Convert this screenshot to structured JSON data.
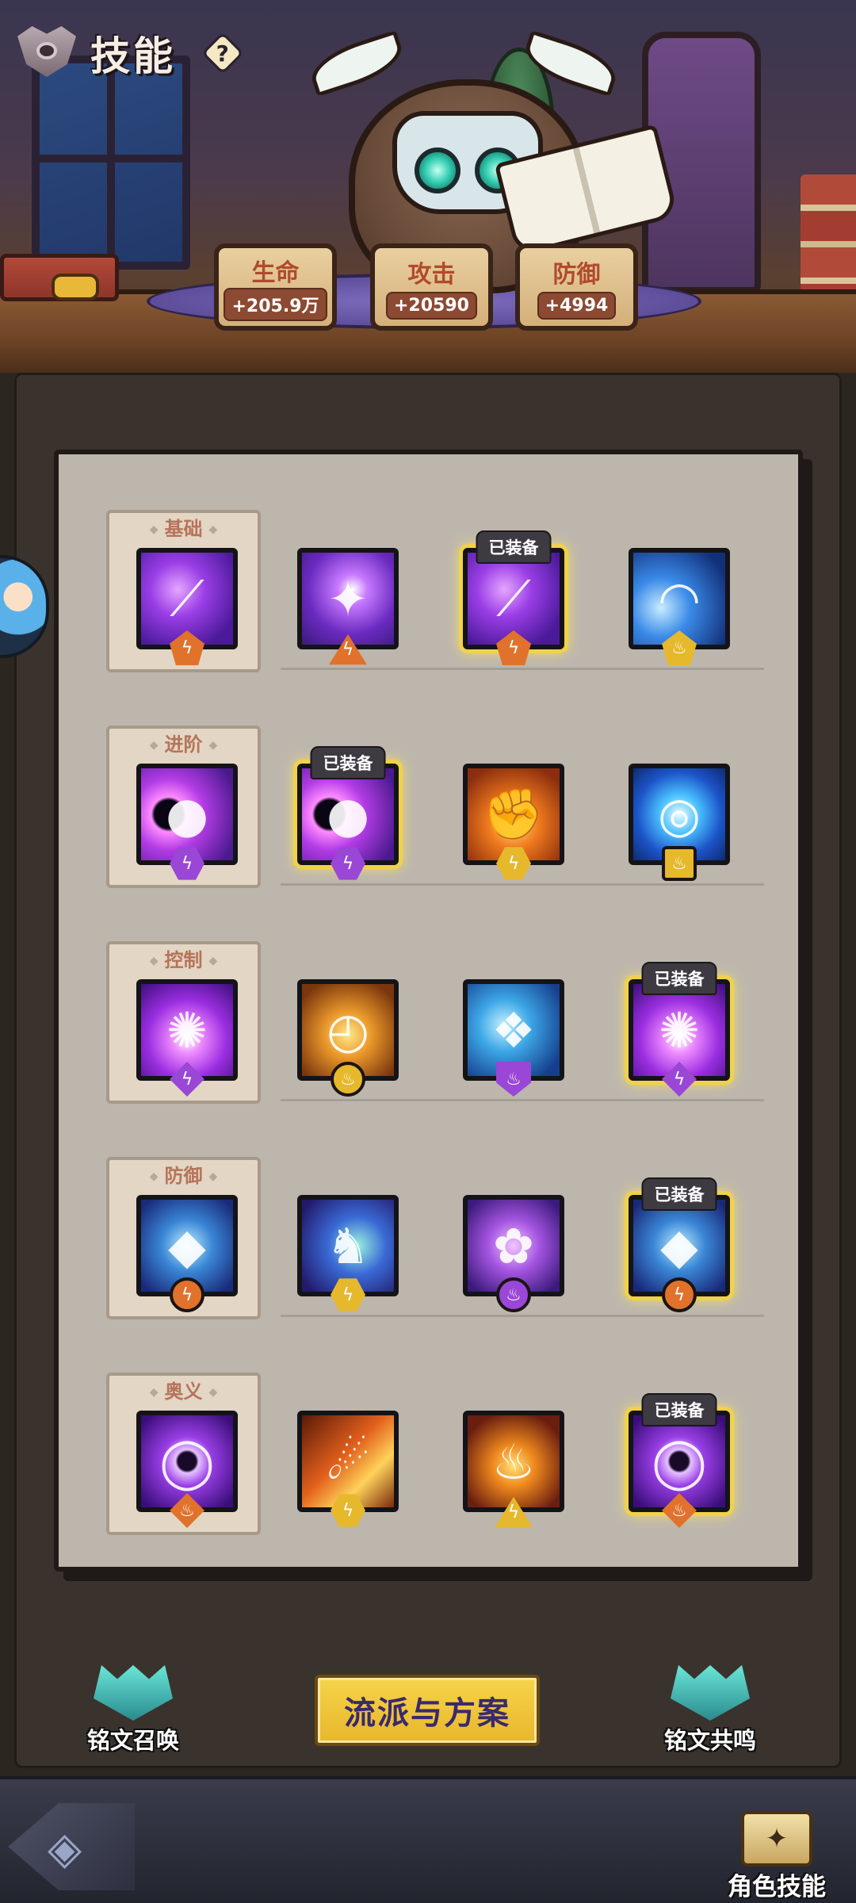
{
  "header": {
    "title": "技能",
    "help_symbol": "?",
    "stats": [
      {
        "label": "生命",
        "value": "+205.9万"
      },
      {
        "label": "攻击",
        "value": "+20590"
      },
      {
        "label": "防御",
        "value": "+4994"
      }
    ]
  },
  "skill_panel": {
    "equipped_tag": "已装备",
    "rows": [
      {
        "category": "基础",
        "skills": [
          {
            "icon": "violet-slash-icon",
            "badge": "orange-lightning",
            "equipped": false
          },
          {
            "icon": "star-burst-icon",
            "badge": "orange-triangle",
            "equipped": false
          },
          {
            "icon": "violet-slash-icon",
            "badge": "orange-lightning",
            "equipped": true
          },
          {
            "icon": "blue-wave-icon",
            "badge": "gold-flame",
            "equipped": false
          }
        ]
      },
      {
        "category": "进阶",
        "skills": [
          {
            "icon": "void-beam-icon",
            "badge": "purple-hex",
            "equipped": false
          },
          {
            "icon": "void-beam-icon",
            "badge": "purple-hex",
            "equipped": true
          },
          {
            "icon": "fire-fist-icon",
            "badge": "gold-hex",
            "equipped": false
          },
          {
            "icon": "water-vortex-icon",
            "badge": "gold-square",
            "equipped": false
          }
        ]
      },
      {
        "category": "控制",
        "skills": [
          {
            "icon": "arcane-burst-icon",
            "badge": "purple-diamond",
            "equipped": false
          },
          {
            "icon": "golden-clock-icon",
            "badge": "gold-circle",
            "equipped": false
          },
          {
            "icon": "frost-ghost-icon",
            "badge": "purple-shield",
            "equipped": false
          },
          {
            "icon": "arcane-burst-icon",
            "badge": "purple-diamond",
            "equipped": true
          }
        ]
      },
      {
        "category": "防御",
        "skills": [
          {
            "icon": "ice-crystal-icon",
            "badge": "orange-circle",
            "equipped": false
          },
          {
            "icon": "twin-spirit-icon",
            "badge": "gold-hex",
            "equipped": false
          },
          {
            "icon": "purple-spirit-icon",
            "badge": "purple-circle",
            "equipped": false
          },
          {
            "icon": "ice-crystal-icon",
            "badge": "orange-circle",
            "equipped": true
          }
        ]
      },
      {
        "category": "奥义",
        "skills": [
          {
            "icon": "dark-ring-icon",
            "badge": "orange-diamond",
            "equipped": false
          },
          {
            "icon": "meteor-icon",
            "badge": "gold-hex",
            "equipped": false
          },
          {
            "icon": "flame-demon-icon",
            "badge": "gold-triangle",
            "equipped": false
          },
          {
            "icon": "dark-ring-icon",
            "badge": "orange-diamond",
            "equipped": true
          }
        ]
      }
    ]
  },
  "bottom": {
    "left_label": "铭文召唤",
    "main_button": "流派与方案",
    "right_label": "铭文共鸣"
  },
  "navbar": {
    "right_label": "角色技能"
  },
  "colors": {
    "equipped_glow": "#f0d24a",
    "paper": "#bdb6ad",
    "button_gold": "#f6d44a"
  }
}
